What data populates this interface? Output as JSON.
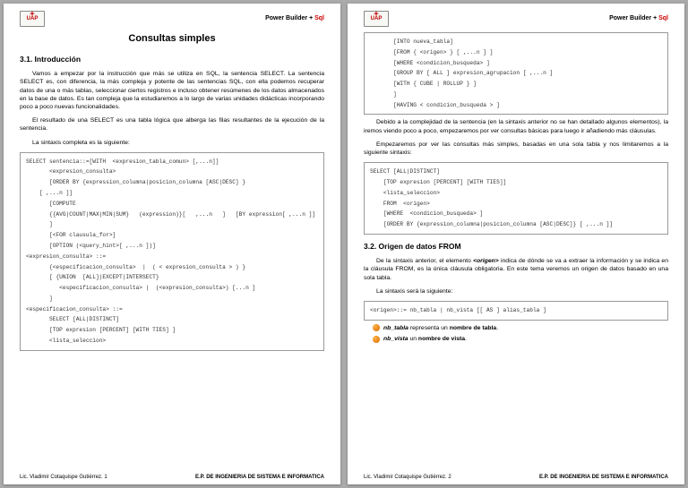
{
  "header": {
    "logo_text": "UAP",
    "right_text_prefix": "Power Builder + ",
    "right_text_suffix": "Sql"
  },
  "title": "Consultas simples",
  "section_1": "3.1. Introducción",
  "para_1": "Vamos a empezar por la instrucción que más se utiliza en SQL, la sentencia SELECT. La sentencia SELECT es, con diferencia, la más compleja y potente de las sentencias SQL, con ella podemos recuperar datos de una o más tablas, seleccionar ciertos registros e incluso obtener resúmenes de los datos almacenados en la base de datos. Es tan compleja que la estudiaremos a lo largo de varias unidades didácticas incorporando poco a poco nuevas funcionalidades.",
  "para_2": "El resultado de una SELECT es una tabla lógica que alberga las filas resultantes de la ejecución de la sentencia.",
  "para_3": "La sintaxis completa es la siguiente:",
  "code_1": "SELECT sentencia::=[WITH  <expresion_tabla_comun> [,...n]]\n       <expresion_consulta>\n       [ORDER BY {expression_columna|posicion_columna [ASC|DESC] }\n    [ ,...n ]]\n       [COMPUTE\n       {{AVG|COUNT|MAX|MIN|SUM}   (expression)}[   ,...n   ]   [BY expression[ ,...n ]]\n       ]\n       [<FOR clausula_for>]\n       [OPTION (<query_hint>[ ,...n ])]\n<expresion_consulta> ::=\n       {<especificacion_consulta>  |  ( < expresion_consulta > ) }\n       [ {UNION  [ALL]|EXCEPT|INTERSECT}\n          <especificacion_consulta> |  (<expresion_consulta>) [...n ]\n       ]\n<especificacion_consulta> ::=\n       SELECT [ALL|DISTINCT]\n       [TOP expresion [PERCENT] [WITH TIES] ]\n       <lista_seleccion>",
  "code_2": "       [INTO nueva_tabla]\n       [FROM { <origen> } [ ,...n ] ]\n       [WHERE <condicion_busqueda> ]\n       [GROUP BY [ ALL ] expresion_agrupacion [ ,...n ]\n       [WITH { CUBE | ROLLUP } ]\n       ]\n       [HAVING < condicion_busqueda > ]",
  "para_4": "Debido a la complejidad de la sentencia (en la sintaxis anterior no se han detallado algunos elementos), la iremos viendo poco a poco, empezaremos por ver consultas básicas para luego ir añadiendo más cláusulas.",
  "para_5": "Empezaremos por ver las consultas más simples, basadas en una sola tabla y nos limitaremos a la siguiente sintaxis:",
  "code_3": "SELECT [ALL|DISTINCT]\n    [TOP expresion [PERCENT] [WITH TIES]]\n    <lista_seleccion>\n    FROM  <origen>\n    [WHERE  <condicion_busqueda> ]\n    [ORDER BY {expression_columna|posicion_columna [ASC|DESC]} [ ,...n ]]",
  "section_2": "3.2. Origen de datos FROM",
  "para_6_prefix": "De la sintaxis anterior, el elemento ",
  "para_6_em": "<origen>",
  "para_6_suffix": " indica de dónde se va a extraer la información y se indica en la cláusula FROM, es la única cláusula obligatoria. En este tema veremos un origen de datos basado en una sola tabla.",
  "para_7": "La sintaxis será la siguiente:",
  "code_4": "<origen>::= nb_tabla | nb_vista [[ AS ] alias_tabla ]",
  "bullet_1_em": "nb_tabla",
  "bullet_1_mid": " representa un ",
  "bullet_1_bold": "nombre de tabla",
  "bullet_2_em": "nb_vista",
  "bullet_2_mid": " un ",
  "bullet_2_bold": "nombre de vista",
  "footer_left_1": "Lic. Vladimir Cotaquispe Gutiérrez. 1",
  "footer_left_2": "Lic. Vladimir Cotaquispe Gutiérrez. 2",
  "footer_right": "E.P. DE INGENIERIA DE SISTEMA E INFORMATICA"
}
